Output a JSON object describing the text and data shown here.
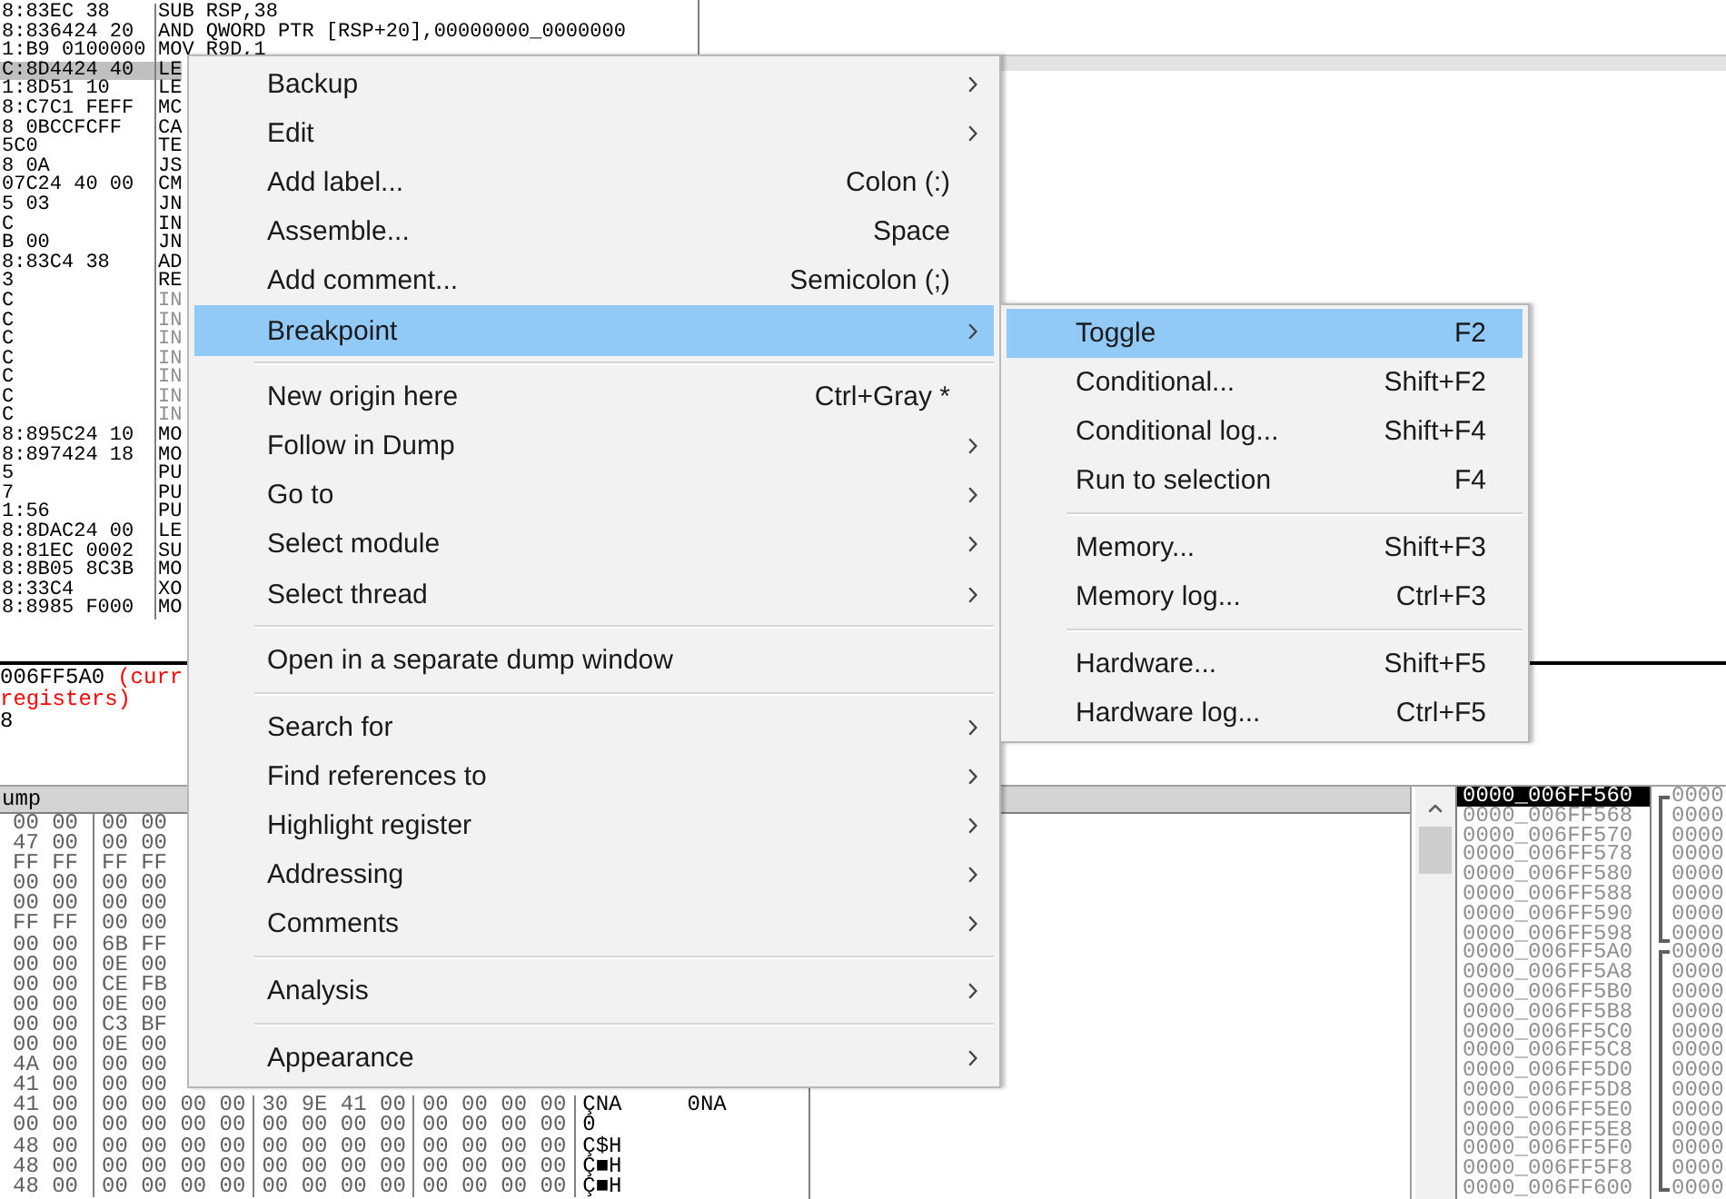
{
  "disassembly": {
    "rows": [
      {
        "bytes": "8:83EC 38",
        "instruction": "SUB RSP,38",
        "selected": false,
        "dimmed": false
      },
      {
        "bytes": "8:836424 20",
        "instruction": "AND QWORD PTR [RSP+20],00000000_0000000",
        "selected": false,
        "dimmed": false
      },
      {
        "bytes": "1:B9 0100000",
        "instruction": "MOV R9D,1",
        "selected": false,
        "dimmed": false
      },
      {
        "bytes": "C:8D4424 40",
        "instruction": "LE",
        "selected": true,
        "dimmed": false
      },
      {
        "bytes": "1:8D51 10",
        "instruction": "LE",
        "selected": false,
        "dimmed": false
      },
      {
        "bytes": "8:C7C1 FEFF",
        "instruction": "MC",
        "selected": false,
        "dimmed": false
      },
      {
        "bytes": "8 0BCCFCFF",
        "instruction": "CA",
        "selected": false,
        "dimmed": false
      },
      {
        "bytes": "5C0",
        "instruction": "TE",
        "selected": false,
        "dimmed": false
      },
      {
        "bytes": "8 0A",
        "instruction": "JS",
        "selected": false,
        "dimmed": false
      },
      {
        "bytes": "07C24 40 00",
        "instruction": "CM",
        "selected": false,
        "dimmed": false
      },
      {
        "bytes": "5 03",
        "instruction": "JN",
        "selected": false,
        "dimmed": false
      },
      {
        "bytes": "C",
        "instruction": "IN",
        "selected": false,
        "dimmed": false
      },
      {
        "bytes": "B 00",
        "instruction": "JN",
        "selected": false,
        "dimmed": false
      },
      {
        "bytes": "8:83C4 38",
        "instruction": "AD",
        "selected": false,
        "dimmed": false
      },
      {
        "bytes": "3",
        "instruction": "RE",
        "selected": false,
        "dimmed": false
      },
      {
        "bytes": "C",
        "instruction": "IN",
        "selected": false,
        "dimmed": true
      },
      {
        "bytes": "C",
        "instruction": "IN",
        "selected": false,
        "dimmed": true
      },
      {
        "bytes": "C",
        "instruction": "IN",
        "selected": false,
        "dimmed": true
      },
      {
        "bytes": "C",
        "instruction": "IN",
        "selected": false,
        "dimmed": true
      },
      {
        "bytes": "C",
        "instruction": "IN",
        "selected": false,
        "dimmed": true
      },
      {
        "bytes": "C",
        "instruction": "IN",
        "selected": false,
        "dimmed": true
      },
      {
        "bytes": "C",
        "instruction": "IN",
        "selected": false,
        "dimmed": true
      },
      {
        "bytes": "8:895C24 10",
        "instruction": "MO",
        "selected": false,
        "dimmed": false
      },
      {
        "bytes": "8:897424 18",
        "instruction": "MO",
        "selected": false,
        "dimmed": false
      },
      {
        "bytes": "5",
        "instruction": "PU",
        "selected": false,
        "dimmed": false
      },
      {
        "bytes": "7",
        "instruction": "PU",
        "selected": false,
        "dimmed": false
      },
      {
        "bytes": "1:56",
        "instruction": "PU",
        "selected": false,
        "dimmed": false
      },
      {
        "bytes": "8:8DAC24 00",
        "instruction": "LE",
        "selected": false,
        "dimmed": false
      },
      {
        "bytes": "8:81EC 0002",
        "instruction": "SU",
        "selected": false,
        "dimmed": false
      },
      {
        "bytes": "8:8B05 8C3B",
        "instruction": "MO",
        "selected": false,
        "dimmed": false
      },
      {
        "bytes": "8:33C4",
        "instruction": "XO",
        "selected": false,
        "dimmed": false
      },
      {
        "bytes": "8:8985 F000",
        "instruction": "MO",
        "selected": false,
        "dimmed": false
      }
    ]
  },
  "info": {
    "lines": [
      {
        "segments": [
          {
            "text": "006FF5A0",
            "color": "#000000"
          },
          {
            "text": "(curr",
            "color": "#ff0000"
          }
        ]
      },
      {
        "segments": [
          {
            "text": "registers)",
            "color": "#ff0000"
          }
        ]
      },
      {
        "segments": [
          {
            "text": "8",
            "color": "#000000"
          }
        ]
      }
    ]
  },
  "dump": {
    "title": "ump",
    "rows": [
      {
        "groups": [
          "00 00",
          "00 00"
        ]
      },
      {
        "groups": [
          "47 00",
          "00 00"
        ]
      },
      {
        "groups": [
          "FF FF",
          "FF FF"
        ]
      },
      {
        "groups": [
          "00 00",
          "00 00"
        ]
      },
      {
        "groups": [
          "00 00",
          "00 00"
        ]
      },
      {
        "groups": [
          "FF FF",
          "00 00"
        ]
      },
      {
        "groups": [
          "00 00",
          "6B FF"
        ]
      },
      {
        "groups": [
          "00 00",
          "0E 00"
        ]
      },
      {
        "groups": [
          "00 00",
          "CE FB"
        ]
      },
      {
        "groups": [
          "00 00",
          "0E 00"
        ]
      },
      {
        "groups": [
          "00 00",
          "C3 BF"
        ]
      },
      {
        "groups": [
          "00 00",
          "0E 00"
        ]
      },
      {
        "groups": [
          "4A 00",
          "00 00"
        ]
      },
      {
        "groups": [
          "41 00",
          "00 00"
        ]
      },
      {
        "groups": [
          "41 00",
          "00 00 00 00",
          "30 9E 41 00",
          "00 00 00 00"
        ],
        "ascii": "ÇNA     0NA"
      },
      {
        "groups": [
          "00 00",
          "00 00 00 00",
          "00 00 00 00",
          "00 00 00 00"
        ],
        "ascii": "0"
      },
      {
        "groups": [
          "48 00",
          "00 00 00 00",
          "00 00 00 00",
          "00 00 00 00"
        ],
        "ascii": "Ç$H"
      },
      {
        "groups": [
          "48 00",
          "00 00 00 00",
          "00 00 00 00",
          "00 00 00 00"
        ],
        "ascii": "Ç■H"
      },
      {
        "groups": [
          "48 00",
          "00 00 00 00",
          "00 00 00 00",
          "00 00 00 00"
        ],
        "ascii": "Ç■H"
      }
    ]
  },
  "stack": {
    "rows": [
      {
        "address": "0000_006FF560",
        "value": "0000",
        "selected": true
      },
      {
        "address": "0000_006FF568",
        "value": "0000",
        "selected": false
      },
      {
        "address": "0000_006FF570",
        "value": "0000",
        "selected": false
      },
      {
        "address": "0000_006FF578",
        "value": "0000",
        "selected": false
      },
      {
        "address": "0000_006FF580",
        "value": "0000",
        "selected": false
      },
      {
        "address": "0000_006FF588",
        "value": "0000",
        "selected": false
      },
      {
        "address": "0000_006FF590",
        "value": "0000",
        "selected": false
      },
      {
        "address": "0000_006FF598",
        "value": "0000",
        "selected": false
      },
      {
        "address": "0000_006FF5A0",
        "value": "0000",
        "selected": false
      },
      {
        "address": "0000_006FF5A8",
        "value": "0000",
        "selected": false
      },
      {
        "address": "0000_006FF5B0",
        "value": "0000",
        "selected": false
      },
      {
        "address": "0000_006FF5B8",
        "value": "0000",
        "selected": false
      },
      {
        "address": "0000_006FF5C0",
        "value": "0000",
        "selected": false
      },
      {
        "address": "0000_006FF5C8",
        "value": "0000",
        "selected": false
      },
      {
        "address": "0000_006FF5D0",
        "value": "0000",
        "selected": false
      },
      {
        "address": "0000_006FF5D8",
        "value": "0000",
        "selected": false
      },
      {
        "address": "0000_006FF5E0",
        "value": "0000",
        "selected": false
      },
      {
        "address": "0000_006FF5E8",
        "value": "0000",
        "selected": false
      },
      {
        "address": "0000_006FF5F0",
        "value": "0000",
        "selected": false
      },
      {
        "address": "0000_006FF5F8",
        "value": "0000",
        "selected": false
      },
      {
        "address": "0000_006FF600",
        "value": "0000",
        "selected": false
      }
    ]
  },
  "context_menu": {
    "items": [
      {
        "kind": "item",
        "label": "Backup",
        "submenu": true,
        "selected": false
      },
      {
        "kind": "item",
        "label": "Edit",
        "submenu": true,
        "selected": false
      },
      {
        "kind": "item",
        "label": "Add label...",
        "shortcut": "Colon (:)",
        "submenu": false,
        "selected": false
      },
      {
        "kind": "item",
        "label": "Assemble...",
        "shortcut": "Space",
        "submenu": false,
        "selected": false
      },
      {
        "kind": "item",
        "label": "Add comment...",
        "shortcut": "Semicolon (;)",
        "submenu": false,
        "selected": false
      },
      {
        "kind": "item",
        "label": "Breakpoint",
        "submenu": true,
        "selected": true
      },
      {
        "kind": "separator"
      },
      {
        "kind": "item",
        "label": "New origin here",
        "shortcut": "Ctrl+Gray *",
        "submenu": false,
        "selected": false
      },
      {
        "kind": "item",
        "label": "Follow in Dump",
        "submenu": true,
        "selected": false
      },
      {
        "kind": "item",
        "label": "Go to",
        "submenu": true,
        "selected": false
      },
      {
        "kind": "item",
        "label": "Select module",
        "submenu": true,
        "selected": false
      },
      {
        "kind": "item",
        "label": "Select thread",
        "submenu": true,
        "selected": false
      },
      {
        "kind": "separator"
      },
      {
        "kind": "item",
        "label": "Open in a separate dump window",
        "submenu": false,
        "selected": false
      },
      {
        "kind": "separator"
      },
      {
        "kind": "item",
        "label": "Search for",
        "submenu": true,
        "selected": false
      },
      {
        "kind": "item",
        "label": "Find references to",
        "submenu": true,
        "selected": false
      },
      {
        "kind": "item",
        "label": "Highlight register",
        "submenu": true,
        "selected": false
      },
      {
        "kind": "item",
        "label": "Addressing",
        "submenu": true,
        "selected": false
      },
      {
        "kind": "item",
        "label": "Comments",
        "submenu": true,
        "selected": false
      },
      {
        "kind": "separator"
      },
      {
        "kind": "item",
        "label": "Analysis",
        "submenu": true,
        "selected": false
      },
      {
        "kind": "separator"
      },
      {
        "kind": "item",
        "label": "Appearance",
        "submenu": true,
        "selected": false
      }
    ]
  },
  "breakpoint_menu": {
    "items": [
      {
        "kind": "item",
        "label": "Toggle",
        "shortcut": "F2",
        "submenu": false,
        "selected": true
      },
      {
        "kind": "item",
        "label": "Conditional...",
        "shortcut": "Shift+F2",
        "submenu": false,
        "selected": false
      },
      {
        "kind": "item",
        "label": "Conditional log...",
        "shortcut": "Shift+F4",
        "submenu": false,
        "selected": false
      },
      {
        "kind": "item",
        "label": "Run to selection",
        "shortcut": "F4",
        "submenu": false,
        "selected": false
      },
      {
        "kind": "separator"
      },
      {
        "kind": "item",
        "label": "Memory...",
        "shortcut": "Shift+F3",
        "submenu": false,
        "selected": false
      },
      {
        "kind": "item",
        "label": "Memory log...",
        "shortcut": "Ctrl+F3",
        "submenu": false,
        "selected": false
      },
      {
        "kind": "separator"
      },
      {
        "kind": "item",
        "label": "Hardware...",
        "shortcut": "Shift+F5",
        "submenu": false,
        "selected": false
      },
      {
        "kind": "item",
        "label": "Hardware log...",
        "shortcut": "Ctrl+F5",
        "submenu": false,
        "selected": false
      }
    ]
  }
}
